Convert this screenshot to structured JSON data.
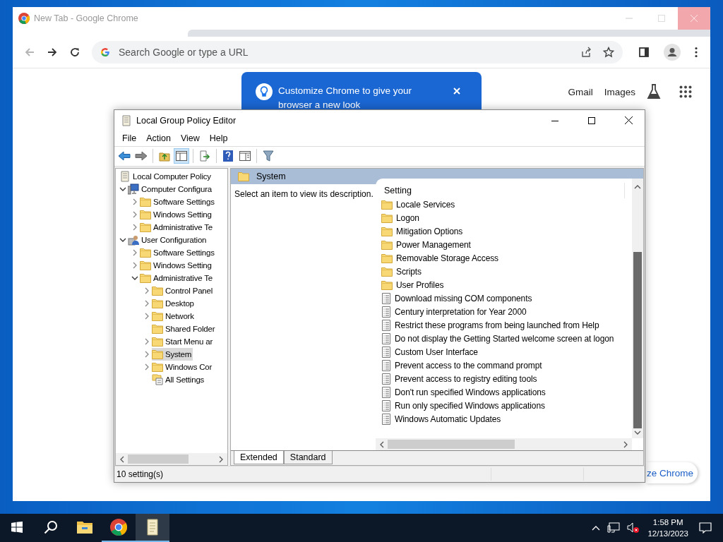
{
  "browser": {
    "title": "New Tab - Google Chrome",
    "nav": [
      {
        "kind": "back",
        "disabled": true
      },
      {
        "kind": "forward",
        "disabled": false
      },
      {
        "kind": "reload",
        "disabled": false
      }
    ],
    "search": {
      "placeholder": "Search Google or type a URL"
    },
    "promo": {
      "text": "Customize Chrome to give your browser a new look"
    },
    "links": [
      "Gmail",
      "Images"
    ],
    "customize_button": "ze Chrome"
  },
  "editor": {
    "title": "Local Group Policy Editor",
    "menu": [
      "File",
      "Action",
      "View",
      "Help"
    ],
    "toolbar": [
      {
        "kind": "back",
        "selected": false
      },
      {
        "kind": "forward",
        "selected": false
      },
      {
        "kind": "up",
        "selected": false
      },
      {
        "kind": "tree",
        "selected": true
      },
      {
        "kind": "export",
        "selected": false
      },
      {
        "kind": "help",
        "selected": false
      },
      {
        "kind": "view",
        "selected": false
      },
      {
        "kind": "filter",
        "selected": false
      }
    ],
    "tree": [
      {
        "label": "Local Computer Policy",
        "kind": "policy",
        "expandable": false,
        "selected": false,
        "children": [
          {
            "label": "Computer Configura",
            "kind": "computer",
            "expandable": true,
            "expanded": true,
            "selected": false,
            "children": [
              {
                "label": "Software Settings",
                "kind": "folder",
                "expandable": true,
                "expanded": false,
                "selected": false
              },
              {
                "label": "Windows Setting",
                "kind": "folder",
                "expandable": true,
                "expanded": false,
                "selected": false
              },
              {
                "label": "Administrative Te",
                "kind": "folder",
                "expandable": true,
                "expanded": false,
                "selected": false
              }
            ]
          },
          {
            "label": "User Configuration",
            "kind": "user",
            "expandable": true,
            "expanded": true,
            "selected": false,
            "children": [
              {
                "label": "Software Settings",
                "kind": "folder",
                "expandable": true,
                "expanded": false,
                "selected": false
              },
              {
                "label": "Windows Setting",
                "kind": "folder",
                "expandable": true,
                "expanded": false,
                "selected": false
              },
              {
                "label": "Administrative Te",
                "kind": "folder",
                "expandable": true,
                "expanded": true,
                "selected": false,
                "children": [
                  {
                    "label": "Control Panel",
                    "kind": "folder",
                    "expandable": true,
                    "expanded": false,
                    "selected": false
                  },
                  {
                    "label": "Desktop",
                    "kind": "folder",
                    "expandable": true,
                    "expanded": false,
                    "selected": false
                  },
                  {
                    "label": "Network",
                    "kind": "folder",
                    "expandable": true,
                    "expanded": false,
                    "selected": false
                  },
                  {
                    "label": "Shared Folder",
                    "kind": "folder",
                    "expandable": false,
                    "selected": false
                  },
                  {
                    "label": "Start Menu ar",
                    "kind": "folder",
                    "expandable": true,
                    "expanded": false,
                    "selected": false
                  },
                  {
                    "label": "System",
                    "kind": "folder",
                    "expandable": true,
                    "expanded": false,
                    "selected": true
                  },
                  {
                    "label": "Windows Cor",
                    "kind": "folder",
                    "expandable": true,
                    "expanded": false,
                    "selected": false
                  },
                  {
                    "label": "All Settings",
                    "kind": "all",
                    "expandable": false,
                    "selected": false
                  }
                ]
              }
            ]
          }
        ]
      }
    ],
    "header": "System",
    "description": "Select an item to view its description.",
    "column": "Setting",
    "settings": [
      {
        "label": "Locale Services",
        "kind": "folder"
      },
      {
        "label": "Logon",
        "kind": "folder"
      },
      {
        "label": "Mitigation Options",
        "kind": "folder"
      },
      {
        "label": "Power Management",
        "kind": "folder"
      },
      {
        "label": "Removable Storage Access",
        "kind": "folder"
      },
      {
        "label": "Scripts",
        "kind": "folder"
      },
      {
        "label": "User Profiles",
        "kind": "folder"
      },
      {
        "label": "Download missing COM components",
        "kind": "setting"
      },
      {
        "label": "Century interpretation for Year 2000",
        "kind": "setting"
      },
      {
        "label": "Restrict these programs from being launched from Help",
        "kind": "setting"
      },
      {
        "label": "Do not display the Getting Started welcome screen at logon",
        "kind": "setting"
      },
      {
        "label": "Custom User Interface",
        "kind": "setting"
      },
      {
        "label": "Prevent access to the command prompt",
        "kind": "setting"
      },
      {
        "label": "Prevent access to registry editing tools",
        "kind": "setting"
      },
      {
        "label": "Don't run specified Windows applications",
        "kind": "setting"
      },
      {
        "label": "Run only specified Windows applications",
        "kind": "setting"
      },
      {
        "label": "Windows Automatic Updates",
        "kind": "setting"
      }
    ],
    "tabs": [
      {
        "label": "Extended",
        "selected": true
      },
      {
        "label": "Standard",
        "selected": false
      }
    ],
    "status": "10 setting(s)"
  },
  "taskbar": {
    "apps": [
      {
        "kind": "explorer",
        "open": false,
        "selected": false
      },
      {
        "kind": "chrome",
        "open": true,
        "selected": false
      },
      {
        "kind": "notepad",
        "open": true,
        "selected": true
      }
    ],
    "time": "1:58 PM",
    "date": "12/13/2023"
  }
}
